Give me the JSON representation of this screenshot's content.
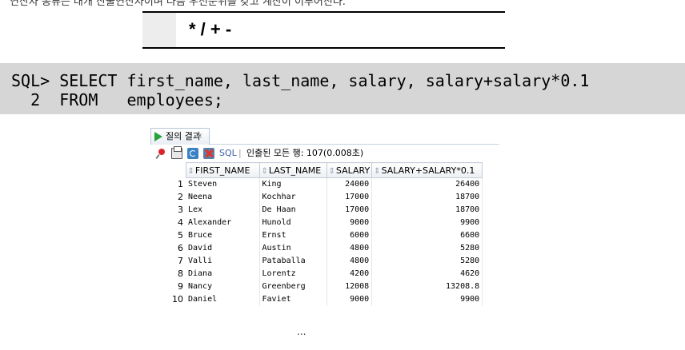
{
  "header_note": "연산자 종류는 대개 산술연산자이며 다음 우선순위를 갖고 계산이 이루어진다.",
  "operators": "* / + -",
  "sql": {
    "line1": "SQL> SELECT first_name, last_name, salary, salary+salary*0.1",
    "line2": "  2  FROM   employees;"
  },
  "results_panel": {
    "tab_label": "질의 결과",
    "tab_close": "×",
    "toolbar": {
      "sql_label": "SQL",
      "separator": "|",
      "status": "인출된 모든 행: 107(0.008초)"
    },
    "columns": [
      "FIRST_NAME",
      "LAST_NAME",
      "SALARY",
      "SALARY+SALARY*0.1"
    ],
    "rows": [
      {
        "n": "1",
        "first_name": "Steven",
        "last_name": "King",
        "salary": "24000",
        "calc": "26400"
      },
      {
        "n": "2",
        "first_name": "Neena",
        "last_name": "Kochhar",
        "salary": "17000",
        "calc": "18700"
      },
      {
        "n": "3",
        "first_name": "Lex",
        "last_name": "De Haan",
        "salary": "17000",
        "calc": "18700"
      },
      {
        "n": "4",
        "first_name": "Alexander",
        "last_name": "Hunold",
        "salary": "9000",
        "calc": "9900"
      },
      {
        "n": "5",
        "first_name": "Bruce",
        "last_name": "Ernst",
        "salary": "6000",
        "calc": "6600"
      },
      {
        "n": "6",
        "first_name": "David",
        "last_name": "Austin",
        "salary": "4800",
        "calc": "5280"
      },
      {
        "n": "7",
        "first_name": "Valli",
        "last_name": "Pataballa",
        "salary": "4800",
        "calc": "5280"
      },
      {
        "n": "8",
        "first_name": "Diana",
        "last_name": "Lorentz",
        "salary": "4200",
        "calc": "4620"
      },
      {
        "n": "9",
        "first_name": "Nancy",
        "last_name": "Greenberg",
        "salary": "12008",
        "calc": "13208.8"
      },
      {
        "n": "10",
        "first_name": "Daniel",
        "last_name": "Faviet",
        "salary": "9000",
        "calc": "9900"
      }
    ],
    "more_indicator": "..."
  },
  "colors": {
    "sql_background": "#d6d6d6",
    "operator_cell": "#ededed",
    "run_icon": "#27a23a"
  }
}
